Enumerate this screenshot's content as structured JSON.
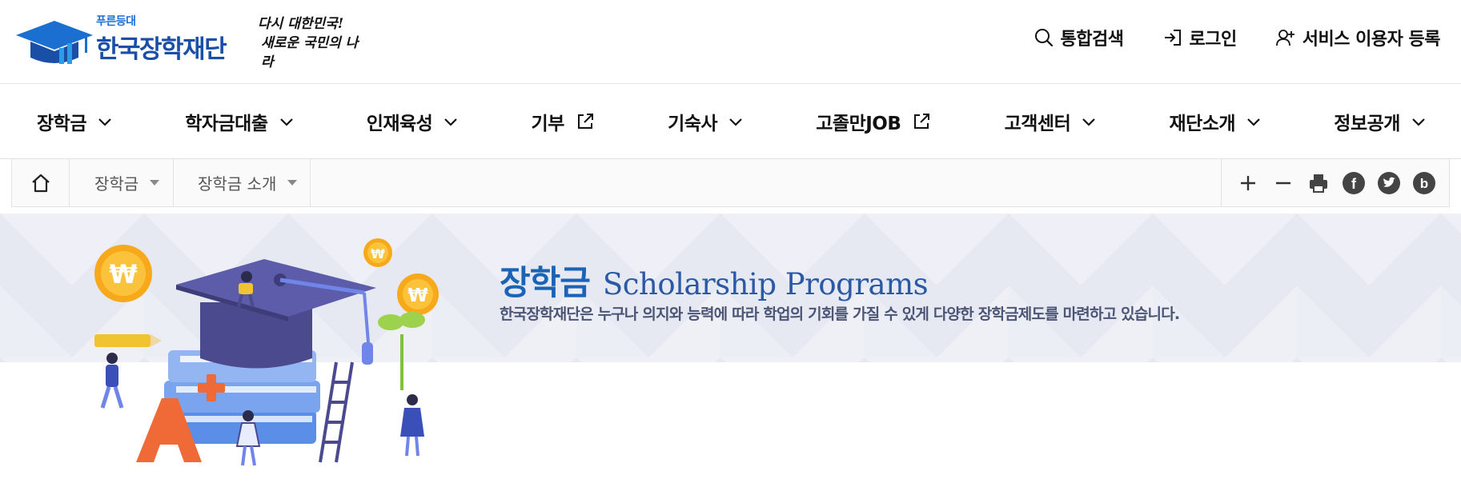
{
  "header": {
    "logo_sub": "푸른등대",
    "logo_main": "한국장학재단",
    "slogan": [
      "다시 대한민국!",
      "새로운 국민의 나라"
    ],
    "util": {
      "search": "통합검색",
      "login": "로그인",
      "register": "서비스 이용자 등록"
    }
  },
  "gnb": {
    "items": [
      {
        "label": "장학금",
        "icon": "chevron-down-icon"
      },
      {
        "label": "학자금대출",
        "icon": "chevron-down-icon"
      },
      {
        "label": "인재육성",
        "icon": "chevron-down-icon"
      },
      {
        "label": "기부",
        "icon": "external-link-icon"
      },
      {
        "label": "기숙사",
        "icon": "chevron-down-icon"
      },
      {
        "label": "고졸만JOB",
        "icon": "external-link-icon"
      },
      {
        "label": "고객센터",
        "icon": "chevron-down-icon"
      },
      {
        "label": "재단소개",
        "icon": "chevron-down-icon"
      },
      {
        "label": "정보공개",
        "icon": "chevron-down-icon"
      }
    ]
  },
  "breadcrumb": {
    "depth1": "장학금",
    "depth2": "장학금 소개",
    "tools": [
      "zoom-in-icon",
      "zoom-out-icon",
      "print-icon",
      "facebook-icon",
      "twitter-icon",
      "blog-icon"
    ]
  },
  "hero": {
    "title_ko": "장학금",
    "title_en": "Scholarship Programs",
    "description": "한국장학재단은 누구나 의지와 능력에 따라 학업의 기회를 가질 수 있게 다양한 장학금제도를 마련하고 있습니다."
  },
  "colors": {
    "brand_blue": "#1a4fa8",
    "hero_title": "#1a63b6",
    "hero_band": "#e9eaf3",
    "coin": "#f7a91b"
  }
}
